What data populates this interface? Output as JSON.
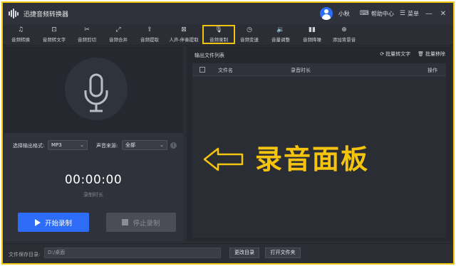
{
  "app": {
    "title": "迅捷音频转换器"
  },
  "header": {
    "user_name": "小秋",
    "help_label": "帮助中心",
    "menu_label": "菜单",
    "minimize": "—",
    "close": "✕"
  },
  "toolbar": {
    "items": [
      {
        "label": "音频转换",
        "icon": "music-note-icon"
      },
      {
        "label": "音频转文字",
        "icon": "text-icon"
      },
      {
        "label": "音频剪切",
        "icon": "scissors-icon"
      },
      {
        "label": "音频合并",
        "icon": "merge-icon"
      },
      {
        "label": "音频提取",
        "icon": "extract-icon"
      },
      {
        "label": "人声-伴奏提取",
        "icon": "voice-separate-icon"
      },
      {
        "label": "音频录制",
        "icon": "microphone-icon"
      },
      {
        "label": "音频变速",
        "icon": "speed-icon"
      },
      {
        "label": "音量调整",
        "icon": "volume-icon"
      },
      {
        "label": "音频降噪",
        "icon": "denoise-icon"
      },
      {
        "label": "添加背景音",
        "icon": "add-background-icon"
      }
    ],
    "active_index": 6
  },
  "recorder": {
    "format_label": "选择输出格式:",
    "format_value": "MP3",
    "source_label": "声音来源:",
    "source_value": "全部",
    "timer": "00:00:00",
    "timer_label": "录制时长",
    "start_label": "开始录制",
    "stop_label": "停止录制"
  },
  "output_list": {
    "title": "输出文件列表",
    "batch_to_text": "批量转文字",
    "batch_remove": "批量移除",
    "columns": [
      "文件名",
      "录音时长",
      "操作"
    ]
  },
  "annotation": {
    "text": "录音面板"
  },
  "footer": {
    "save_dir_label": "文件保存目录:",
    "save_dir_value": "D:/桌面",
    "change_dir_label": "更改目录",
    "open_folder_label": "打开文件夹"
  },
  "colors": {
    "accent": "#2d6cf6",
    "highlight": "#f1c40f",
    "background": "#2b2e35"
  }
}
